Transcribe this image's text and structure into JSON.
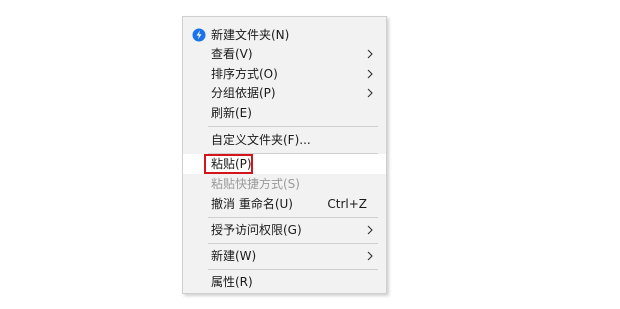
{
  "context_menu": {
    "items": [
      {
        "label": "新建文件夹(N)"
      },
      {
        "label": "查看(V)"
      },
      {
        "label": "排序方式(O)"
      },
      {
        "label": "分组依据(P)"
      },
      {
        "label": "刷新(E)"
      },
      {
        "label": "自定义文件夹(F)..."
      },
      {
        "label": "粘贴(P)"
      },
      {
        "label": "粘贴快捷方式(S)"
      },
      {
        "label": "撤消 重命名(U)",
        "shortcut": "Ctrl+Z"
      },
      {
        "label": "授予访问权限(G)"
      },
      {
        "label": "新建(W)"
      },
      {
        "label": "属性(R)"
      }
    ]
  },
  "colors": {
    "menu_background": "#f2f2f2",
    "hover_background": "#ffffff",
    "disabled_text": "#9a9a9a",
    "highlight_border": "#d6141b",
    "new_folder_icon": "#1a73e8"
  }
}
